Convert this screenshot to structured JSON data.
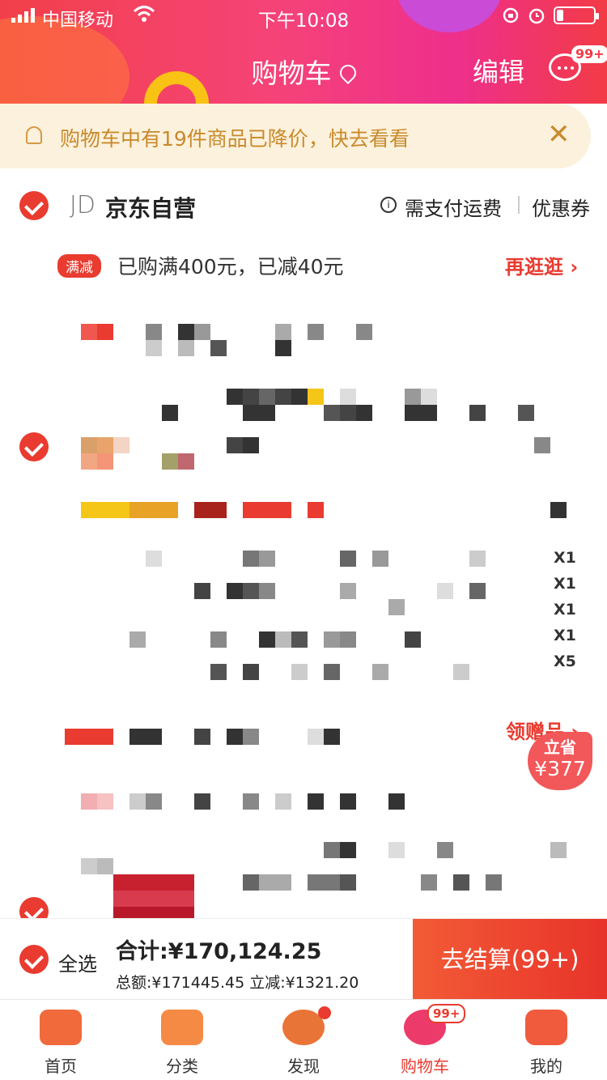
{
  "status_bar": {
    "carrier": "中国移动",
    "time": "下午10:08"
  },
  "nav": {
    "title": "购物车",
    "edit_label": "编辑",
    "message_badge": "99+"
  },
  "notice": {
    "text": "购物车中有19件商品已降价，快去看看",
    "close": "✕"
  },
  "shop": {
    "logo": "JD",
    "name": "京东自营",
    "shipping_label": "需支付运费",
    "coupon_label": "优惠券",
    "promo_tag": "满减",
    "promo_text": "已购满400元，已减40元",
    "more_label": "再逛逛 ›"
  },
  "gift_items": {
    "quantities": [
      "X1",
      "X1",
      "X1",
      "X1",
      "X5"
    ]
  },
  "gift_link": "领赠品 ›",
  "save_badge": {
    "title": "立省",
    "amount": "¥377"
  },
  "checkout": {
    "select_all": "全选",
    "total": "合计:¥170,124.25",
    "subtotal": "总额:¥171445.45 立减:¥1321.20",
    "button": "去结算(99+)"
  },
  "tabs": [
    {
      "label": "首页"
    },
    {
      "label": "分类"
    },
    {
      "label": "发现"
    },
    {
      "label": "购物车",
      "badge": "99+"
    },
    {
      "label": "我的"
    }
  ],
  "colors": {
    "accent": "#e93b2f",
    "notice_bg": "#fcf1dc"
  }
}
